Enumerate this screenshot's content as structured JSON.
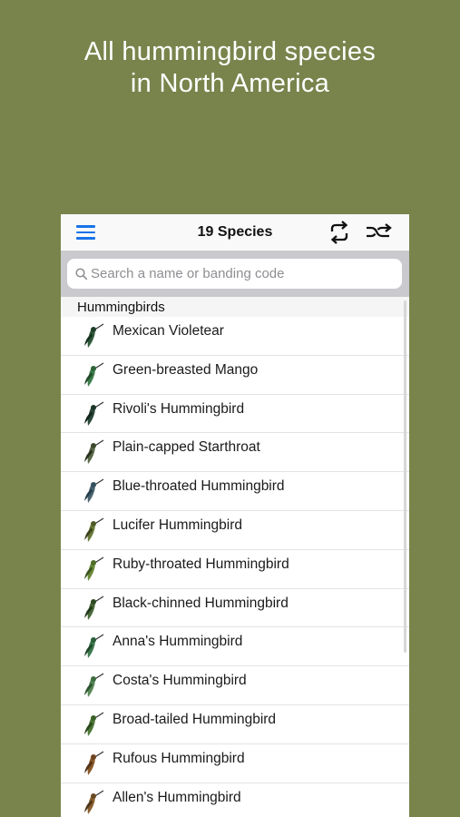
{
  "promo": {
    "line1": "All hummingbird species",
    "line2": "in North America"
  },
  "navbar": {
    "title": "19 Species",
    "menu_icon": "hamburger-menu-icon",
    "sync_icon": "sync-icon",
    "shuffle_icon": "shuffle-icon",
    "accent_color": "#1a73e8"
  },
  "search": {
    "placeholder": "Search a name or banding code",
    "value": ""
  },
  "section": {
    "title": "Hummingbirds"
  },
  "species": [
    {
      "name": "Mexican Violetear"
    },
    {
      "name": "Green-breasted Mango"
    },
    {
      "name": "Rivoli's Hummingbird"
    },
    {
      "name": "Plain-capped Starthroat"
    },
    {
      "name": "Blue-throated Hummingbird"
    },
    {
      "name": "Lucifer Hummingbird"
    },
    {
      "name": "Ruby-throated Hummingbird"
    },
    {
      "name": "Black-chinned Hummingbird"
    },
    {
      "name": "Anna's Hummingbird"
    },
    {
      "name": "Costa's Hummingbird"
    },
    {
      "name": "Broad-tailed Hummingbird"
    },
    {
      "name": "Rufous Hummingbird"
    },
    {
      "name": "Allen's Hummingbird"
    }
  ],
  "colors": {
    "background": "#78844c",
    "search_bar": "#c9c9ce"
  }
}
